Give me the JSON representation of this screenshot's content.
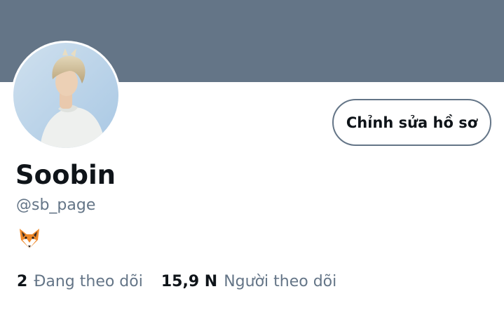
{
  "profile": {
    "name": "Soobin",
    "handle": "@sb_page",
    "bio_icon": "fox-emoji",
    "edit_button_label": "Chỉnh sửa hồ sơ"
  },
  "stats": {
    "following_count": "2",
    "following_label": "Đang theo dõi",
    "followers_count": "15,9 N",
    "followers_label": "Người theo dõi"
  },
  "colors": {
    "banner": "#647587",
    "text_primary": "#0f1419",
    "text_secondary": "#647587"
  }
}
